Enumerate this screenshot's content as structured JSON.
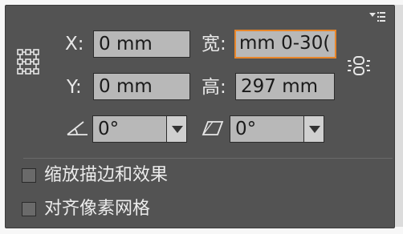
{
  "panel": {
    "menu_icon": "panel-menu-icon",
    "reference_point_icon": "reference-point-grid-icon",
    "constrain_icon": "constrain-proportions-link-icon",
    "x_label": "X:",
    "x_value": "0 mm",
    "y_label": "Y:",
    "y_value": "0 mm",
    "width_label": "宽:",
    "width_value": ")0-30 mm",
    "height_label": "高:",
    "height_value": "297 mm",
    "rotate_icon": "rotate-angle-icon",
    "rotate_value": "0°",
    "shear_icon": "shear-angle-icon",
    "shear_value": "0°",
    "scale_strokes_label": "缩放描边和效果",
    "scale_strokes_checked": false,
    "align_to_pixel_label": "对齐像素网格",
    "align_to_pixel_checked": false
  },
  "colors": {
    "panel_bg": "#535353",
    "field_bg": "#b8b8b8",
    "focus_ring": "#e8862a"
  }
}
